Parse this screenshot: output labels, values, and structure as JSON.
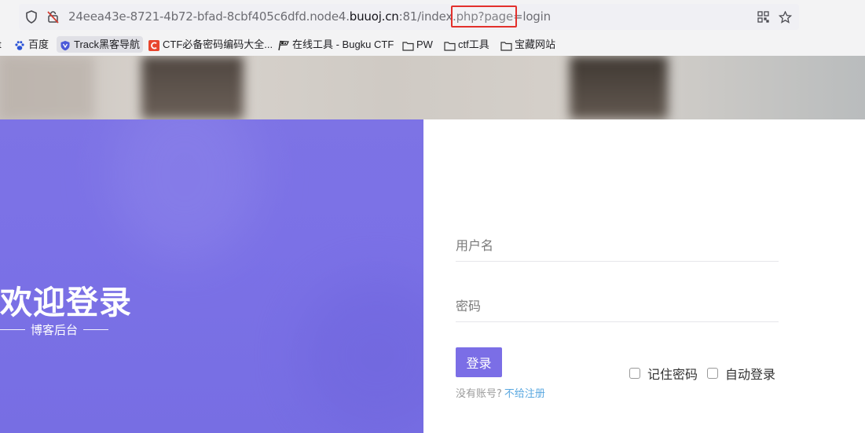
{
  "browser": {
    "url_host": "24eea43e-8721-4b72-bfad-8cbf405c6dfd.node4.",
    "url_domain": "buuoj.cn",
    "url_rest": ":81/index.php?",
    "url_query": "page=login"
  },
  "bookmarks": [
    {
      "label": "百度",
      "icon": "paw-icon"
    },
    {
      "label": "Track黑客导航",
      "icon": "shield-icon"
    },
    {
      "label": "CTF必备密码编码大全...",
      "icon": "c-logo-icon"
    },
    {
      "label": "在线工具 - Bugku CTF",
      "icon": "flag-icon"
    },
    {
      "label": "PW",
      "icon": "folder-icon"
    },
    {
      "label": "ctf工具",
      "icon": "folder-icon"
    },
    {
      "label": "宝藏网站",
      "icon": "folder-icon"
    }
  ],
  "left": {
    "welcome": "欢迎登录",
    "subtitle": "博客后台"
  },
  "form": {
    "username_placeholder": "用户名",
    "password_placeholder": "密码",
    "login_label": "登录",
    "remember_label": "记住密码",
    "autologin_label": "自动登录",
    "no_account": "没有账号?",
    "register_link": "不给注册"
  },
  "colors": {
    "accent": "#7b6ee6",
    "link": "#5aa8e0",
    "highlight": "#e3302c"
  }
}
